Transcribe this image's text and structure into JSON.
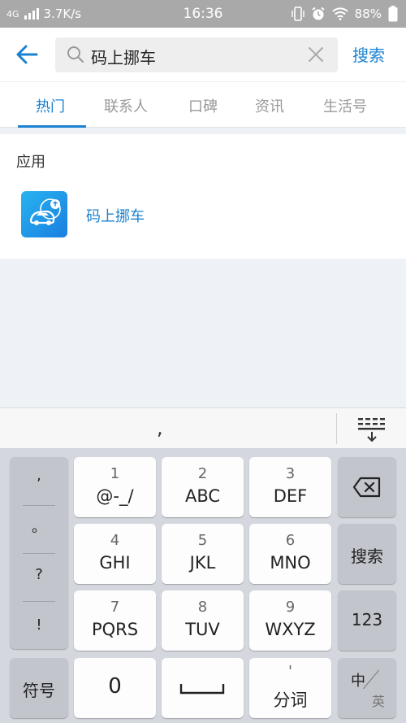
{
  "status_bar": {
    "network": "4G",
    "speed": "3.7K/s",
    "time": "16:36",
    "battery": "88%",
    "icons": [
      "signal-icon",
      "vibrate-icon",
      "alarm-icon",
      "wifi-icon",
      "battery-icon"
    ]
  },
  "header": {
    "query": "码上挪车",
    "search_label": "搜索",
    "accent": "#1b82d1"
  },
  "tabs": [
    {
      "label": "热门",
      "active": true
    },
    {
      "label": "联系人",
      "active": false
    },
    {
      "label": "口碑",
      "active": false
    },
    {
      "label": "资讯",
      "active": false
    },
    {
      "label": "生活号",
      "active": false
    }
  ],
  "results": {
    "section_title": "应用",
    "app": {
      "name": "码上挪车",
      "icon": "car-app-icon"
    }
  },
  "keyboard": {
    "candidate": ",",
    "punctuation": [
      ",",
      "。",
      "?",
      "!"
    ],
    "keys": [
      {
        "num": "1",
        "letters": "@-_/"
      },
      {
        "num": "2",
        "letters": "ABC"
      },
      {
        "num": "3",
        "letters": "DEF"
      },
      {
        "num": "4",
        "letters": "GHI"
      },
      {
        "num": "5",
        "letters": "JKL"
      },
      {
        "num": "6",
        "letters": "MNO"
      },
      {
        "num": "7",
        "letters": "PQRS"
      },
      {
        "num": "8",
        "letters": "TUV"
      },
      {
        "num": "9",
        "letters": "WXYZ"
      }
    ],
    "search_key": "搜索",
    "num_mode": "123",
    "symbols": "符号",
    "zero": "0",
    "split_top": "'",
    "split_label": "分词",
    "zh": "中",
    "en": "英"
  }
}
